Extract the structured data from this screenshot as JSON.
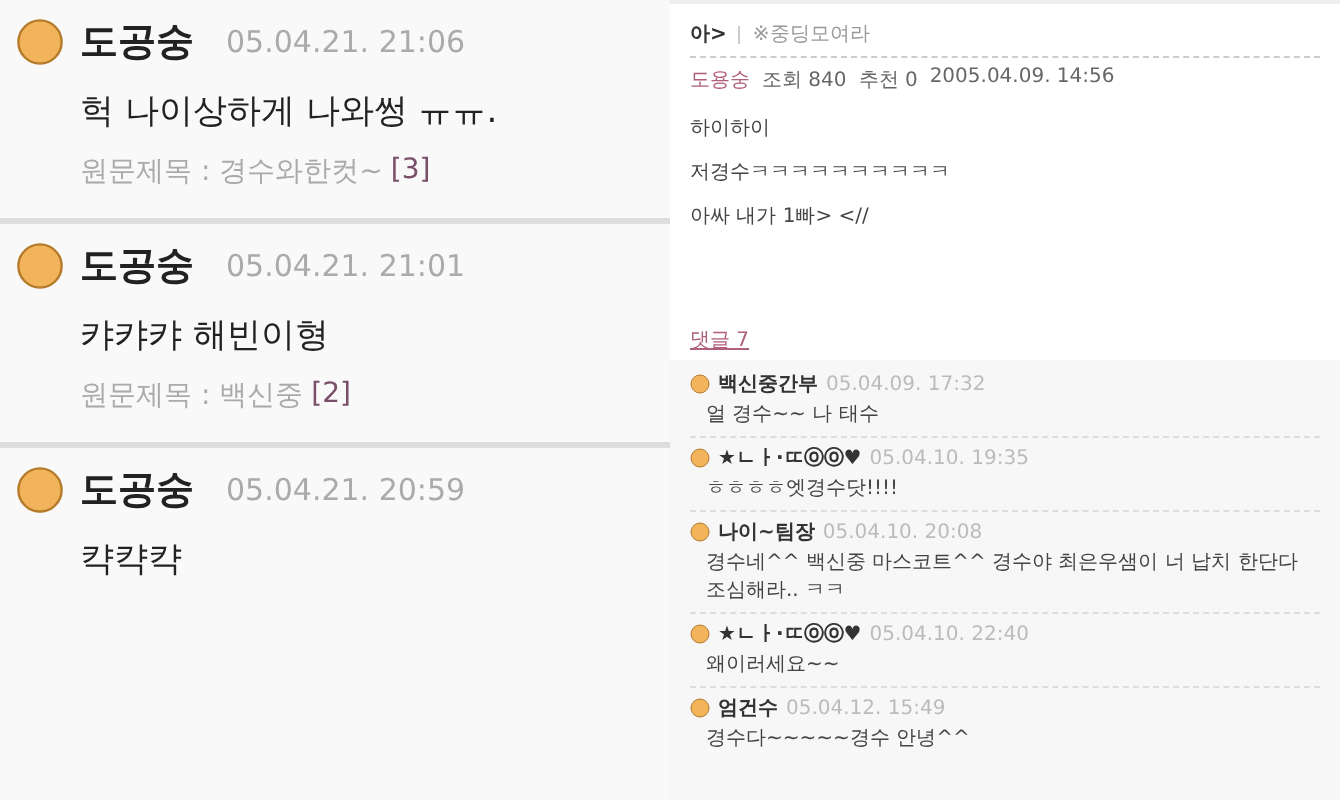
{
  "left_posts": [
    {
      "author": "도공숭",
      "time": "05.04.21. 21:06",
      "message": "헉 나이상하게 나와썽 ㅠㅠ.",
      "source_label": "원문제목 : 경수와한컷~",
      "count": "[3]"
    },
    {
      "author": "도공숭",
      "time": "05.04.21. 21:01",
      "message": "캬캬캬 해빈이형",
      "source_label": "원문제목 : 백신중",
      "count": "[2]"
    },
    {
      "author": "도공숭",
      "time": "05.04.21. 20:59",
      "message": "캭캭캭"
    }
  ],
  "article": {
    "category": "아>",
    "title": "※중딩모여라",
    "author": "도용숭",
    "views": "조회 840",
    "likes": "추천 0",
    "date": "2005.04.09. 14:56",
    "body": [
      "하이하이",
      "저경수ㅋㅋㅋㅋㅋㅋㅋㅋㅋㅋ",
      "아싸 내가 1빠> <//"
    ]
  },
  "comments_header": "댓글 7",
  "comments": [
    {
      "author": "백신중간부",
      "time": "05.04.09. 17:32",
      "text": "얼 경수~~ 나 태수"
    },
    {
      "author": "★ㄴㅏ·ㄸⓞⓞ♥",
      "time": "05.04.10. 19:35",
      "text": "ㅎㅎㅎㅎ엣경수닷!!!!"
    },
    {
      "author": "나이~팀장",
      "time": "05.04.10. 20:08",
      "text": "경수네^^ 백신중 마스코트^^ 경수야 최은우샘이 너 납치 한단다 조심해라.. ㅋㅋ"
    },
    {
      "author": "★ㄴㅏ·ㄸⓞⓞ♥",
      "time": "05.04.10. 22:40",
      "text": "왜이러세요~~"
    },
    {
      "author": "엄건수",
      "time": "05.04.12. 15:49",
      "text": "경수다~~~~~경수 안녕^^"
    }
  ]
}
